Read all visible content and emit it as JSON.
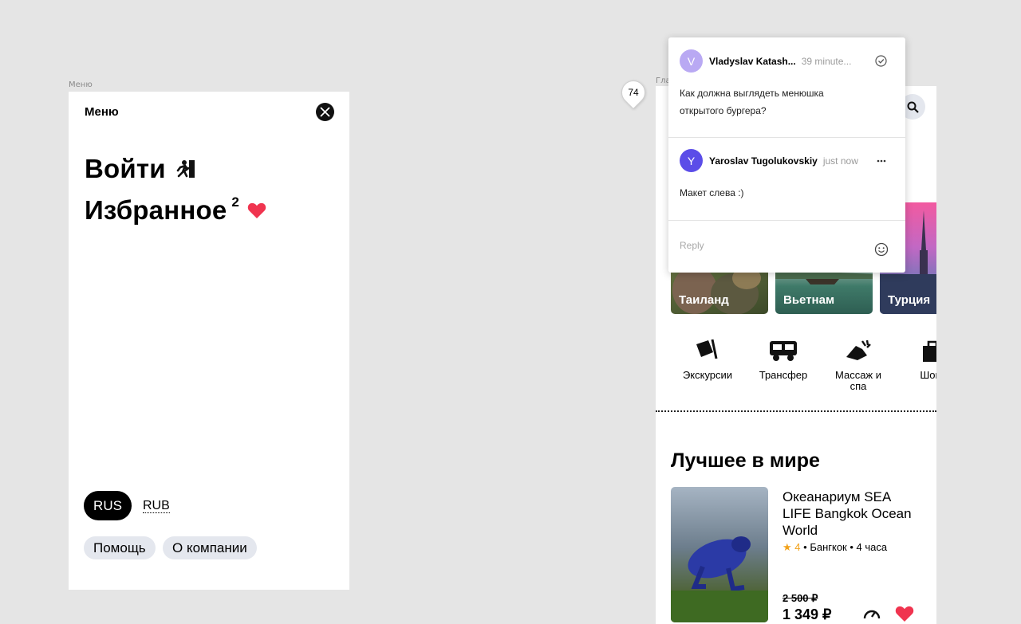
{
  "menu_frame": {
    "frame_label": "Меню",
    "title": "Меню",
    "links": [
      {
        "label": "Войти"
      },
      {
        "label": "Избранное",
        "badge": "2"
      }
    ],
    "language": "RUS",
    "currency": "RUB",
    "tags": [
      "Помощь",
      "О компании"
    ]
  },
  "main_frame": {
    "frame_label": "Гла",
    "destinations": [
      "Таиланд",
      "Вьетнам",
      "Турция"
    ],
    "categories": [
      {
        "label": "Экскурсии",
        "icon": "flag-icon"
      },
      {
        "label": "Трансфер",
        "icon": "car-icon"
      },
      {
        "label": "Массаж и спа",
        "icon": "massage-hands-icon"
      },
      {
        "label": "Шопп",
        "icon": "shopping-bag-icon"
      }
    ],
    "section_title": "Лучшее в мире",
    "product": {
      "title": "Океанариум SEA LIFE Bangkok Ocean World",
      "rating": "4",
      "city": "Бангкок",
      "duration": "4 часа",
      "old_price": "2 500 ₽",
      "new_price": "1 349 ₽"
    }
  },
  "comment_pin": {
    "count": "74"
  },
  "comments": [
    {
      "initial": "V",
      "author": "Vladyslav Katash...",
      "time": "39 minute...",
      "text": "Как должна выглядеть менюшка открытого бургера?",
      "avatar_color": "#b9a9f3"
    },
    {
      "initial": "Y",
      "author": "Yaroslav Tugolukovskiy",
      "time": "just now",
      "text": "Макет слева :)",
      "avatar_color": "#5b4de8"
    }
  ],
  "reply_placeholder": "Reply",
  "colors": {
    "heart": "#f0344f",
    "star": "#f2a21b",
    "pill_bg": "#e4e7ee"
  }
}
